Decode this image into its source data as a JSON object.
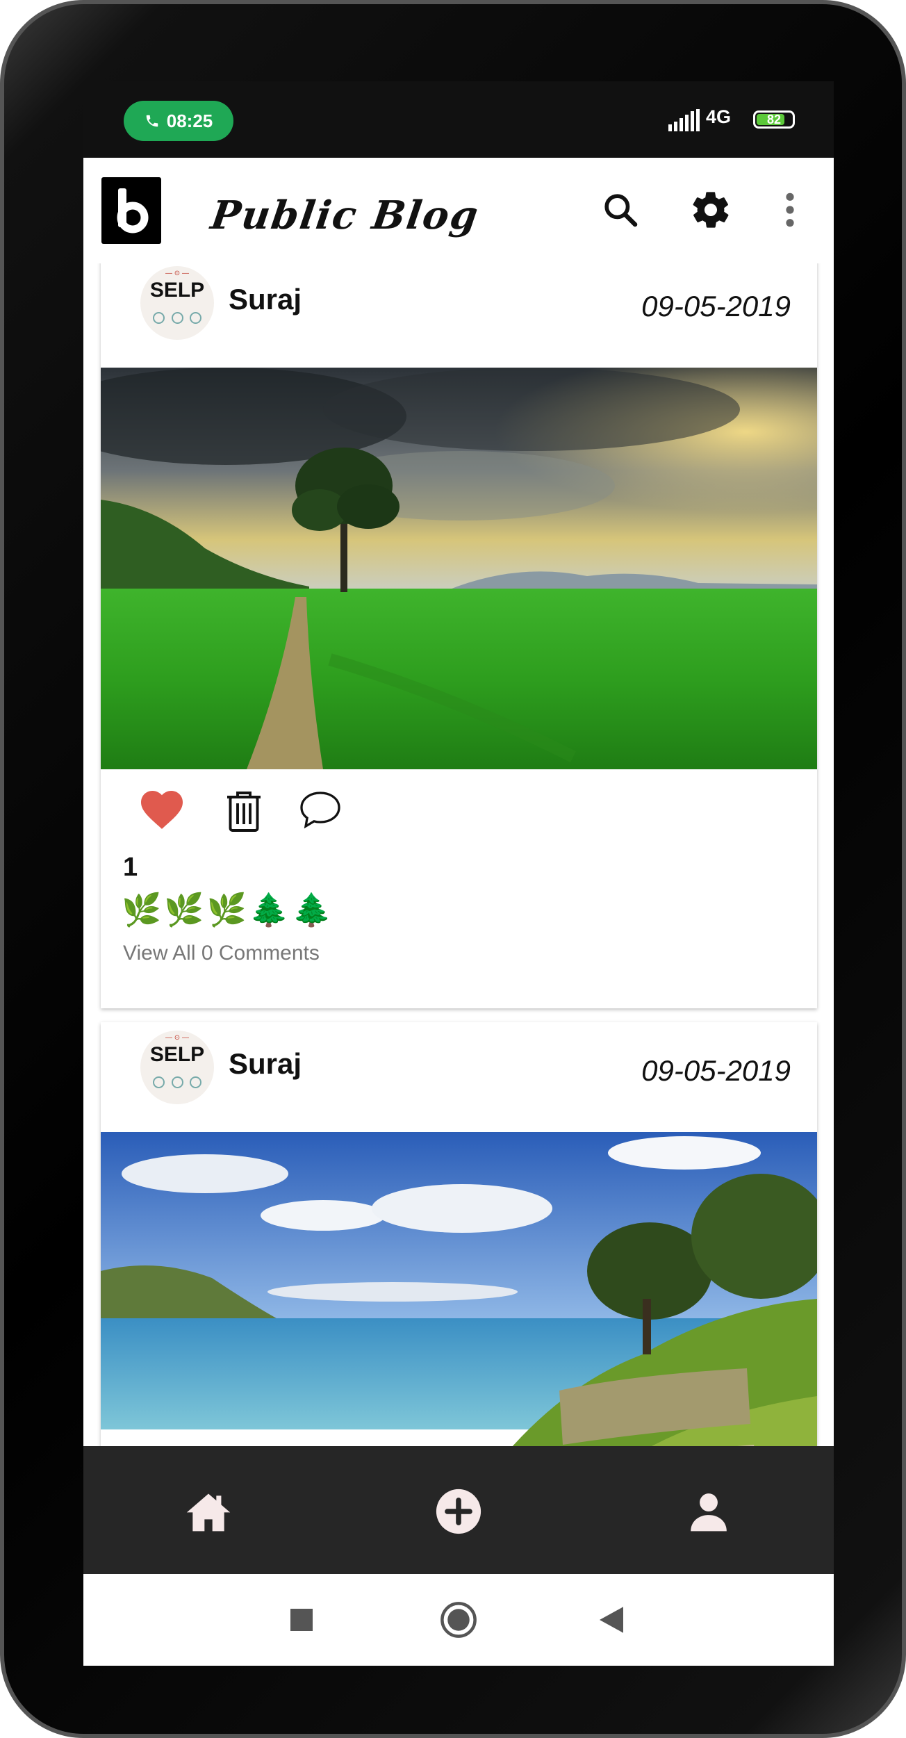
{
  "status_bar": {
    "call_time": "08:25",
    "network": "4G",
    "battery_level": "82",
    "battery_fraction": 0.82
  },
  "app_bar": {
    "title": "Public Blog",
    "icons": [
      "search-icon",
      "settings-gear-icon",
      "more-vert-icon"
    ]
  },
  "posts": [
    {
      "author": "Suraj",
      "avatar_text": "SELP",
      "date": "09-05-2019",
      "image": "green field with lone tree under cloudy sky",
      "liked": true,
      "like_count": "1",
      "emojis": "🌿🌿🌿🌲🌲",
      "comments_link": "View All 0 Comments"
    },
    {
      "author": "Suraj",
      "avatar_text": "SELP",
      "date": "09-05-2019",
      "image": "coastal lake view with bench on grassy hill"
    }
  ],
  "bottom_nav": [
    "home-icon",
    "add-post-icon",
    "profile-icon"
  ],
  "system_nav": [
    "recents-icon",
    "home-circle-icon",
    "back-icon"
  ],
  "colors": {
    "status_bg": "#111111",
    "call_pill": "#1fa855",
    "heart": "#e05a4e",
    "bottom_nav_bg": "#262626",
    "nav_icon": "#f6e9e9"
  }
}
